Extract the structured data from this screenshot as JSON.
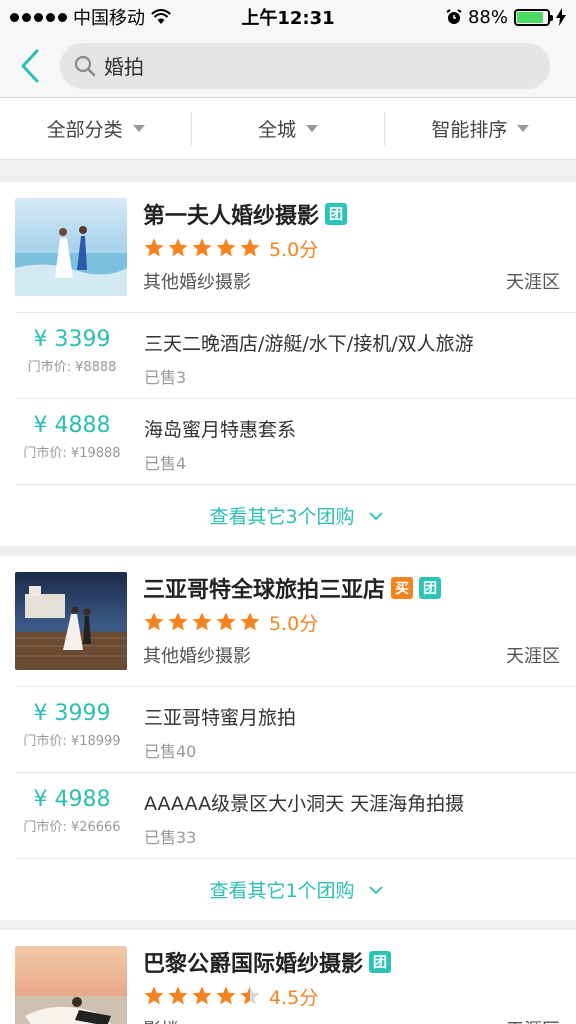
{
  "status_bar": {
    "carrier": "中国移动",
    "time": "上午12:31",
    "battery": "88%",
    "battery_level": 0.88
  },
  "search": {
    "query": "婚拍"
  },
  "filters": [
    {
      "label": "全部分类"
    },
    {
      "label": "全城"
    },
    {
      "label": "智能排序"
    }
  ],
  "shops": [
    {
      "name": "第一夫人婚纱摄影",
      "tags": [
        "团"
      ],
      "rating": 5.0,
      "score_label": "5.0分",
      "category": "其他婚纱摄影",
      "district": "天涯区",
      "deals": [
        {
          "price": "¥ 3399",
          "market": "门市价: ¥8888",
          "title": "三天二晚酒店/游艇/水下/接机/双人旅游",
          "sold": "已售3"
        },
        {
          "price": "¥ 4888",
          "market": "门市价: ¥19888",
          "title": "海岛蜜月特惠套系",
          "sold": "已售4"
        }
      ],
      "more": "查看其它3个团购"
    },
    {
      "name": "三亚哥特全球旅拍三亚店",
      "tags": [
        "买",
        "团"
      ],
      "rating": 5.0,
      "score_label": "5.0分",
      "category": "其他婚纱摄影",
      "district": "天涯区",
      "deals": [
        {
          "price": "¥ 3999",
          "market": "门市价: ¥18999",
          "title": "三亚哥特蜜月旅拍",
          "sold": "已售40"
        },
        {
          "price": "¥ 4988",
          "market": "门市价: ¥26666",
          "title": "AAAAA级景区大小洞天 天涯海角拍摄",
          "sold": "已售33"
        }
      ],
      "more": "查看其它1个团购"
    },
    {
      "name": "巴黎公爵国际婚纱摄影",
      "tags": [
        "团"
      ],
      "rating": 4.5,
      "score_label": "4.5分",
      "category": "影楼",
      "district": "天涯区"
    }
  ]
}
